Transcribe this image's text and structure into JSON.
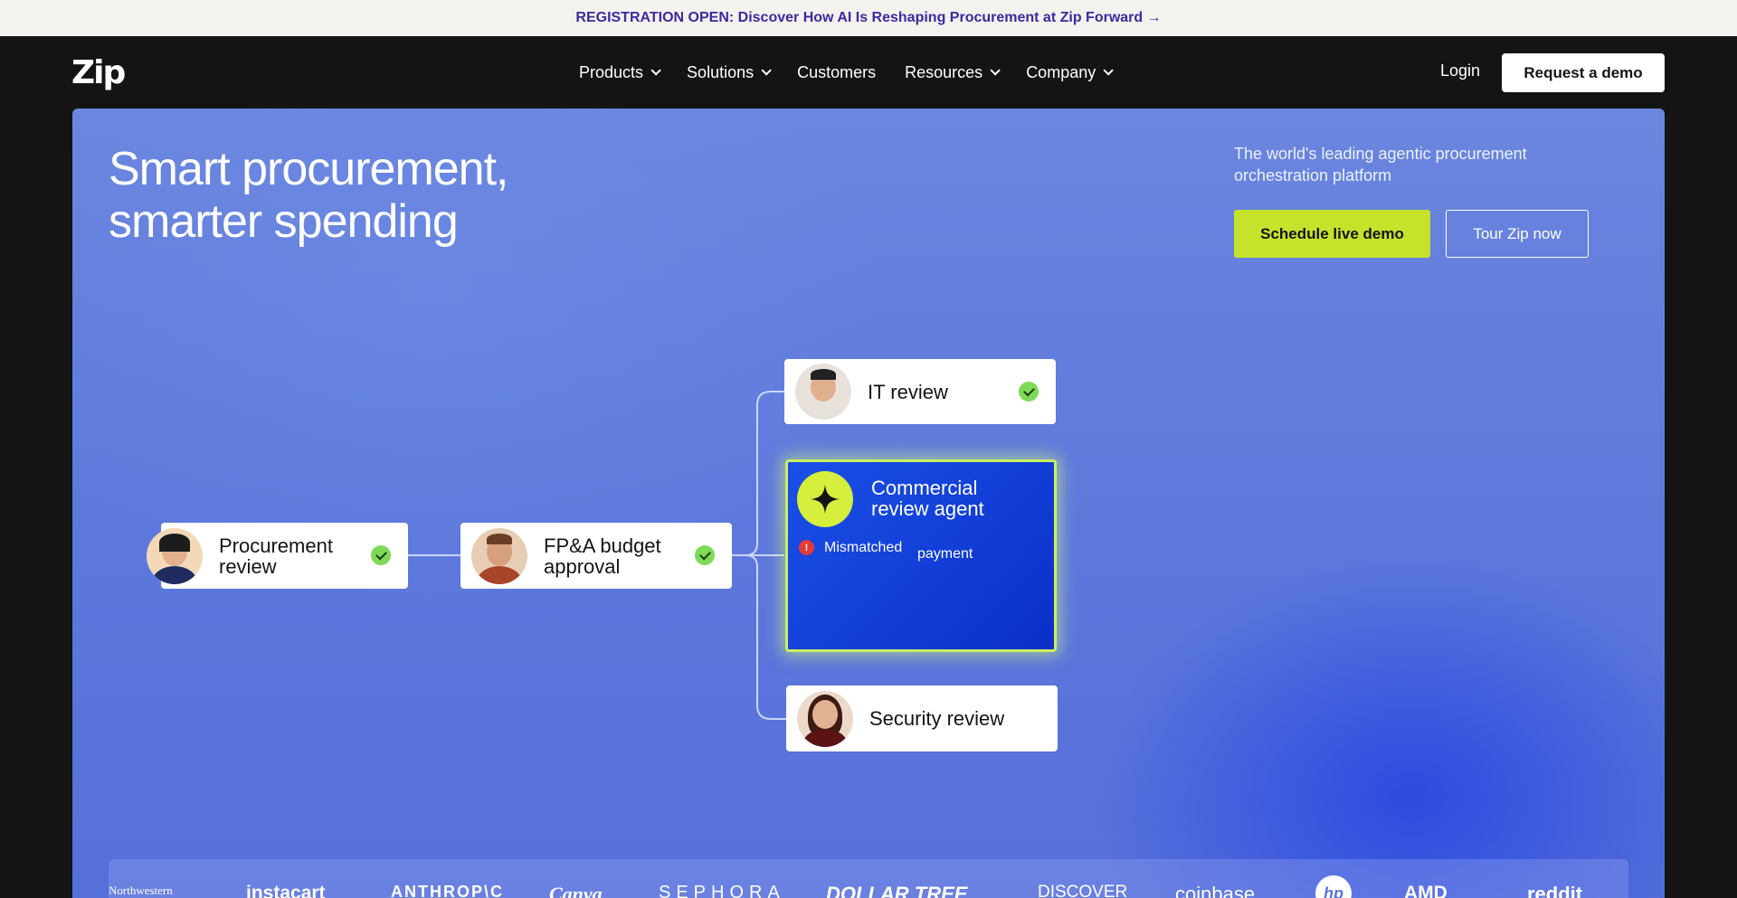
{
  "announcement": {
    "text": "REGISTRATION OPEN: Discover How AI Is Reshaping Procurement at Zip Forward →"
  },
  "nav": {
    "logo": "Zip",
    "items": [
      {
        "label": "Products",
        "dropdown": true
      },
      {
        "label": "Solutions",
        "dropdown": true
      },
      {
        "label": "Customers",
        "dropdown": false
      },
      {
        "label": "Resources",
        "dropdown": true
      },
      {
        "label": "Company",
        "dropdown": true
      }
    ],
    "login": "Login",
    "demo": "Request a demo"
  },
  "hero": {
    "title_line1": "Smart procurement,",
    "title_line2": "smarter spending",
    "tagline": "The world's leading agentic procurement orchestration platform",
    "primary_cta": "Schedule live demo",
    "secondary_cta": "Tour Zip now"
  },
  "workflow": {
    "procurement": {
      "line1": "Procurement",
      "line2": "review",
      "approved": true
    },
    "fpa": {
      "line1": "FP&A budget",
      "line2": "approval",
      "approved": true
    },
    "it": {
      "label": "IT review",
      "approved": true
    },
    "agent": {
      "line1": "Commercial",
      "line2": "review agent",
      "alert1": "Mismatched",
      "alert2": "payment",
      "alert_icon": "!"
    },
    "security": {
      "label": "Security review",
      "approved": false
    }
  },
  "colors": {
    "accent": "#c6e22b",
    "hero_blue": "#5d79dc",
    "agent_blue": "#1a50e8",
    "check_green": "#7ed957"
  },
  "logos": [
    "Northwestern",
    "instacart",
    "ANTHROP\\C",
    "Canva",
    "SEPHORA",
    "DOLLAR TREE",
    "DISCOVER",
    "coinbase",
    "hp",
    "AMD",
    "reddit"
  ]
}
